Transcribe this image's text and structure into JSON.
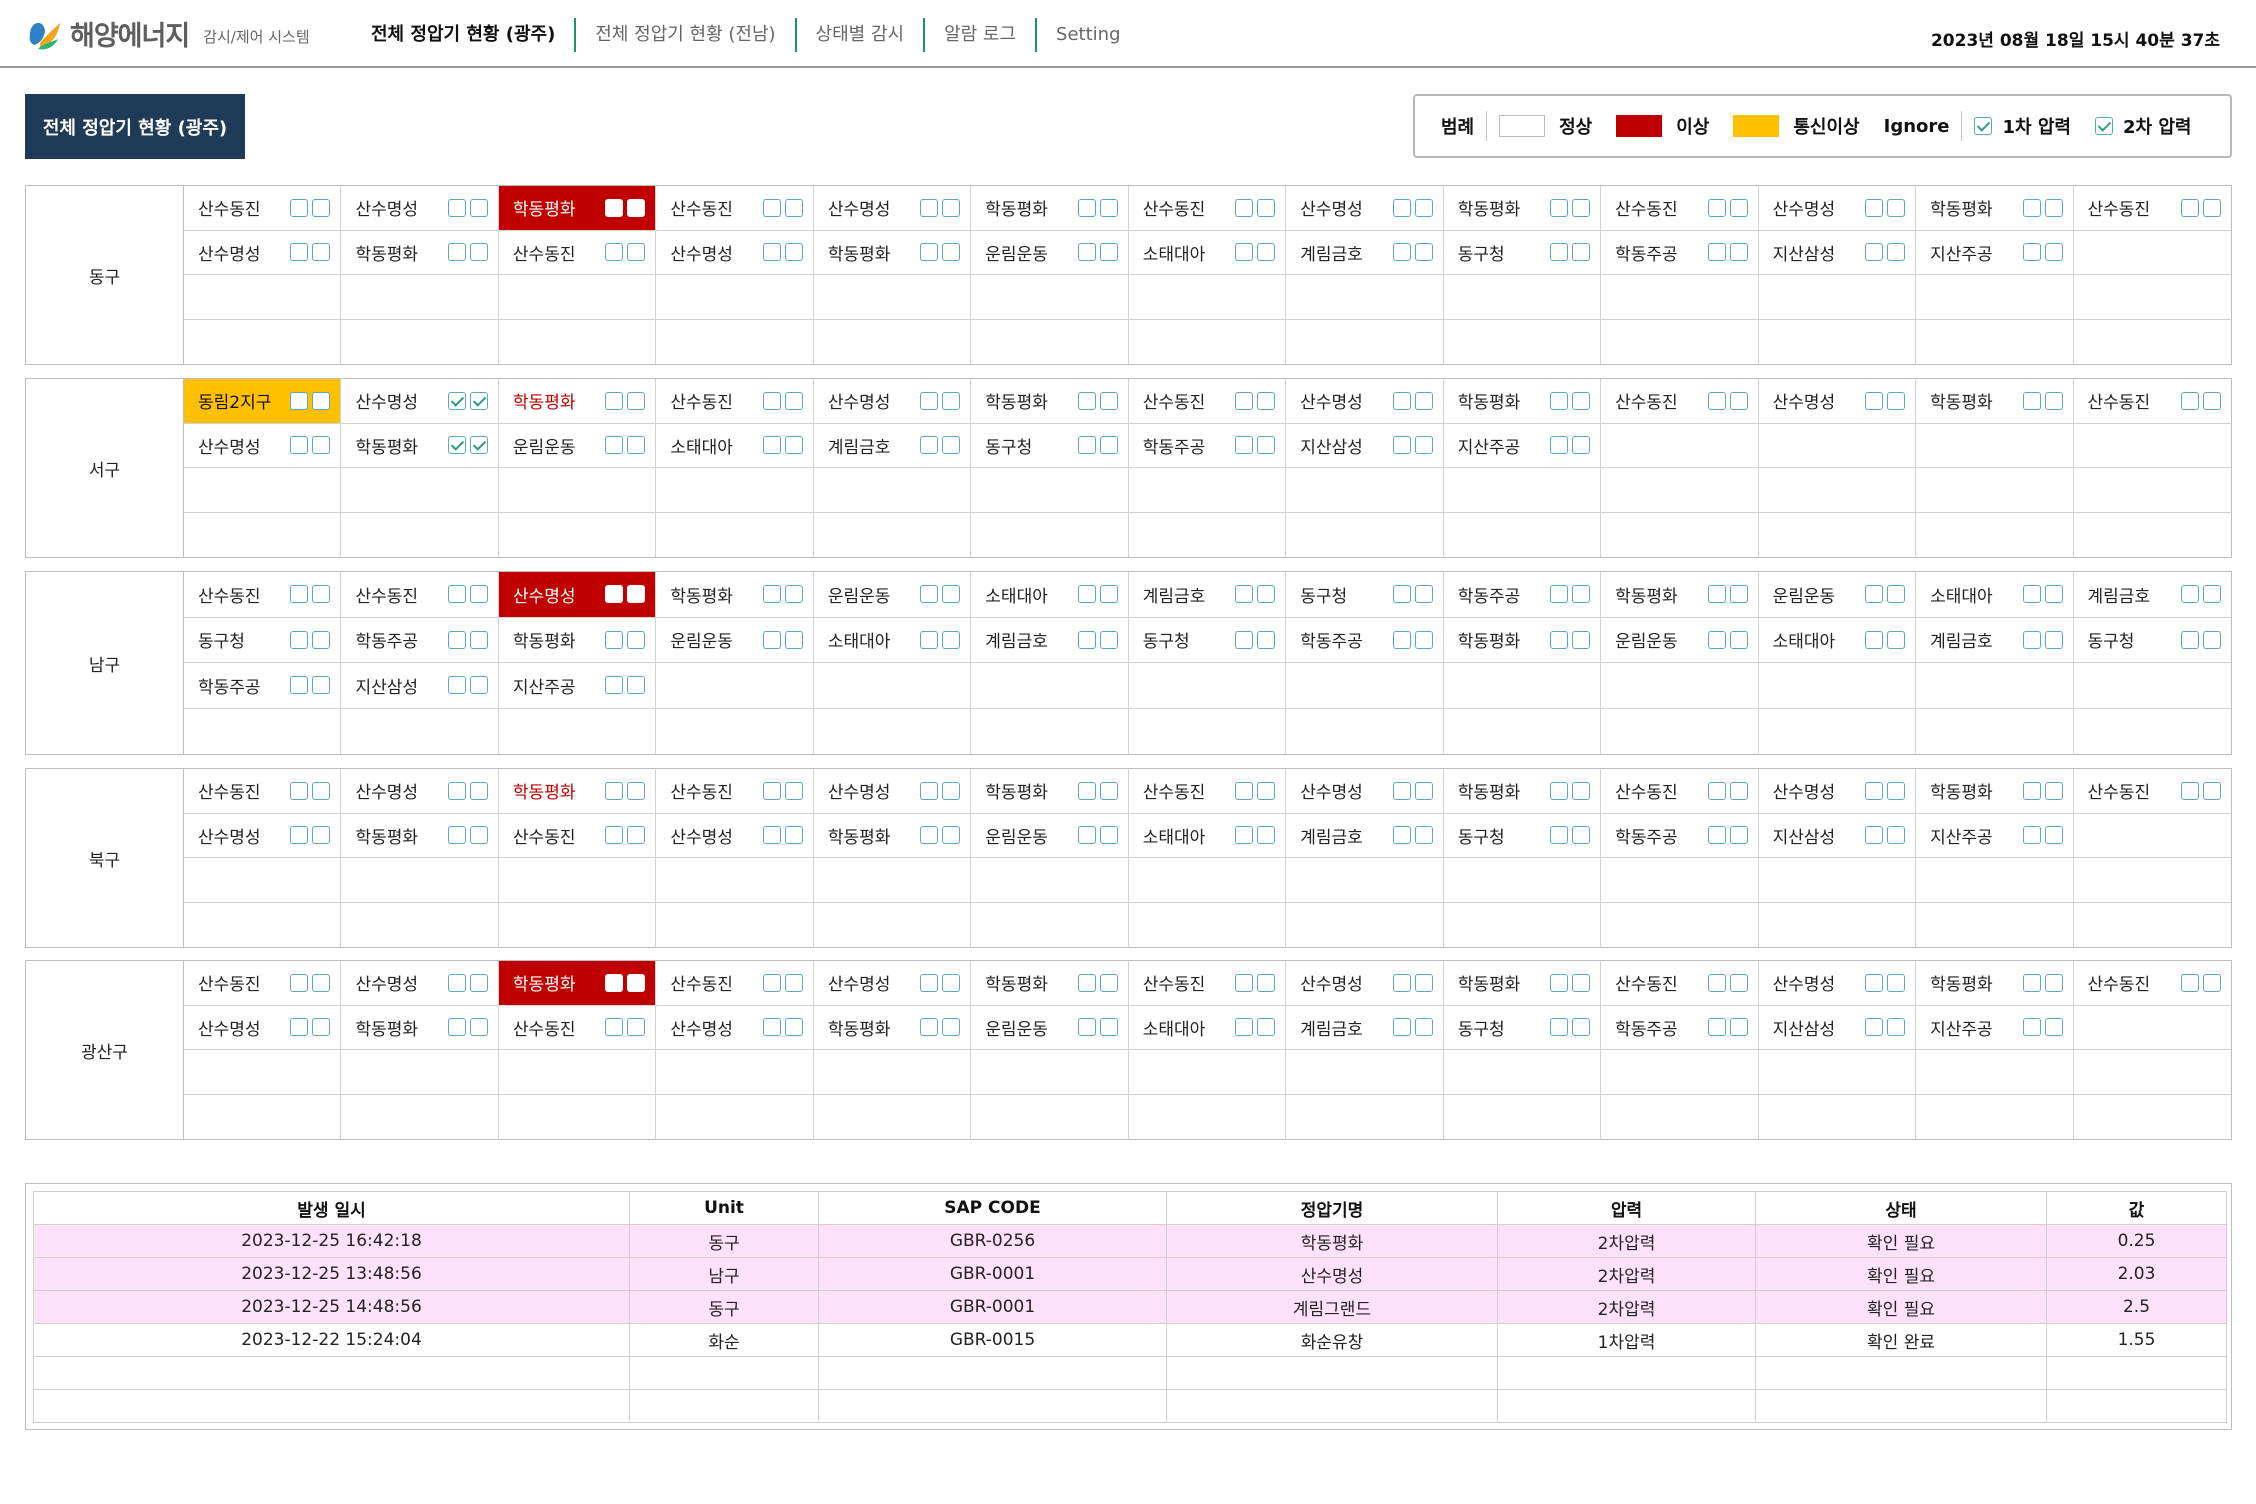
{
  "header": {
    "brand": "해양에너지",
    "subtitle": "감시/제어 시스템",
    "nav": [
      {
        "label": "전체 정압기 현황 (광주)",
        "active": true
      },
      {
        "label": "전체 정압기 현황 (전남)",
        "active": false
      },
      {
        "label": "상태별 감시",
        "active": false
      },
      {
        "label": "알람 로그",
        "active": false
      },
      {
        "label": "Setting",
        "active": false
      }
    ],
    "datetime": "2023년 08월 18일 15시 40분 37초"
  },
  "page_title": "전체 정압기 현황 (광주)",
  "legend": {
    "title": "범례",
    "normal": "정상",
    "abnormal": "이상",
    "comm_error": "통신이상",
    "ignore": "Ignore",
    "first_pressure": "1차 압력",
    "second_pressure": "2차 압력"
  },
  "colors": {
    "abnormal": "#c00000",
    "comm_error": "#ffc000",
    "normal": "#ffffff",
    "title_bg": "#1f3b57",
    "log_highlight": "#ffe1fa"
  },
  "regions": [
    {
      "name": "동구",
      "rows": [
        [
          "산수동진|",
          "산수명성|",
          "학동평화|alarm",
          "산수동진|",
          "산수명성|",
          "학동평화|",
          "산수동진|",
          "산수명성|",
          "학동평화|",
          "산수동진|",
          "산수명성|",
          "학동평화|",
          "산수동진|"
        ],
        [
          "산수명성|",
          "학동평화|",
          "산수동진|",
          "산수명성|",
          "학동평화|",
          "운림운동|",
          "소태대아|",
          "계림금호|",
          "동구청|",
          "학동주공|",
          "지산삼성|",
          "지산주공|",
          ""
        ],
        [
          "",
          "",
          "",
          "",
          "",
          "",
          "",
          "",
          "",
          "",
          "",
          "",
          ""
        ],
        [
          "",
          "",
          "",
          "",
          "",
          "",
          "",
          "",
          "",
          "",
          "",
          "",
          ""
        ]
      ]
    },
    {
      "name": "서구",
      "rows": [
        [
          "동림2지구|comm",
          "산수명성|check",
          "학동평화|redtext",
          "산수동진|",
          "산수명성|",
          "학동평화|",
          "산수동진|",
          "산수명성|",
          "학동평화|",
          "산수동진|",
          "산수명성|",
          "학동평화|",
          "산수동진|"
        ],
        [
          "산수명성|",
          "학동평화|check",
          "운림운동|",
          "소태대아|",
          "계림금호|",
          "동구청|",
          "학동주공|",
          "지산삼성|",
          "지산주공|",
          "",
          "",
          "",
          ""
        ],
        [
          "",
          "",
          "",
          "",
          "",
          "",
          "",
          "",
          "",
          "",
          "",
          "",
          ""
        ],
        [
          "",
          "",
          "",
          "",
          "",
          "",
          "",
          "",
          "",
          "",
          "",
          "",
          ""
        ]
      ]
    },
    {
      "name": "남구",
      "rows": [
        [
          "산수동진|",
          "산수동진|",
          "산수명성|alarm",
          "학동평화|",
          "운림운동|",
          "소태대아|",
          "계림금호|",
          "동구청|",
          "학동주공|",
          "학동평화|",
          "운림운동|",
          "소태대아|",
          "계림금호|"
        ],
        [
          "동구청|",
          "학동주공|",
          "학동평화|",
          "운림운동|",
          "소태대아|",
          "계림금호|",
          "동구청|",
          "학동주공|",
          "학동평화|",
          "운림운동|",
          "소태대아|",
          "계림금호|",
          "동구청|"
        ],
        [
          "학동주공|",
          "지산삼성|",
          "지산주공|",
          "",
          "",
          "",
          "",
          "",
          "",
          "",
          "",
          "",
          ""
        ],
        [
          "",
          "",
          "",
          "",
          "",
          "",
          "",
          "",
          "",
          "",
          "",
          "",
          ""
        ]
      ]
    },
    {
      "name": "북구",
      "rows": [
        [
          "산수동진|",
          "산수명성|",
          "학동평화|redtext",
          "산수동진|",
          "산수명성|",
          "학동평화|",
          "산수동진|",
          "산수명성|",
          "학동평화|",
          "산수동진|",
          "산수명성|",
          "학동평화|",
          "산수동진|"
        ],
        [
          "산수명성|",
          "학동평화|",
          "산수동진|",
          "산수명성|",
          "학동평화|",
          "운림운동|",
          "소태대아|",
          "계림금호|",
          "동구청|",
          "학동주공|",
          "지산삼성|",
          "지산주공|",
          ""
        ],
        [
          "",
          "",
          "",
          "",
          "",
          "",
          "",
          "",
          "",
          "",
          "",
          "",
          ""
        ],
        [
          "",
          "",
          "",
          "",
          "",
          "",
          "",
          "",
          "",
          "",
          "",
          "",
          ""
        ]
      ]
    },
    {
      "name": "광산구",
      "rows": [
        [
          "산수동진|",
          "산수명성|",
          "학동평화|alarm",
          "산수동진|",
          "산수명성|",
          "학동평화|",
          "산수동진|",
          "산수명성|",
          "학동평화|",
          "산수동진|",
          "산수명성|",
          "학동평화|",
          "산수동진|"
        ],
        [
          "산수명성|",
          "학동평화|",
          "산수동진|",
          "산수명성|",
          "학동평화|",
          "운림운동|",
          "소태대아|",
          "계림금호|",
          "동구청|",
          "학동주공|",
          "지산삼성|",
          "지산주공|",
          ""
        ],
        [
          "",
          "",
          "",
          "",
          "",
          "",
          "",
          "",
          "",
          "",
          "",
          "",
          ""
        ],
        [
          "",
          "",
          "",
          "",
          "",
          "",
          "",
          "",
          "",
          "",
          "",
          "",
          ""
        ]
      ]
    }
  ],
  "log": {
    "columns": [
      "발생 일시",
      "Unit",
      "SAP CODE",
      "정압기명",
      "압력",
      "상태",
      "값"
    ],
    "rows": [
      {
        "highlight": true,
        "cells": [
          "2023-12-25 16:42:18",
          "동구",
          "GBR-0256",
          "학동평화",
          "2차압력",
          "확인 필요",
          "0.25"
        ]
      },
      {
        "highlight": true,
        "cells": [
          "2023-12-25 13:48:56",
          "남구",
          "GBR-0001",
          "산수명성",
          "2차압력",
          "확인 필요",
          "2.03"
        ]
      },
      {
        "highlight": true,
        "cells": [
          "2023-12-25 14:48:56",
          "동구",
          "GBR-0001",
          "계림그랜드",
          "2차압력",
          "확인 필요",
          "2.5"
        ]
      },
      {
        "highlight": false,
        "cells": [
          "2023-12-22 15:24:04",
          "화순",
          "GBR-0015",
          "화순유창",
          "1차압력",
          "확인 완료",
          "1.55"
        ]
      },
      {
        "highlight": false,
        "cells": [
          "",
          "",
          "",
          "",
          "",
          "",
          ""
        ]
      },
      {
        "highlight": false,
        "cells": [
          "",
          "",
          "",
          "",
          "",
          "",
          ""
        ]
      }
    ]
  }
}
